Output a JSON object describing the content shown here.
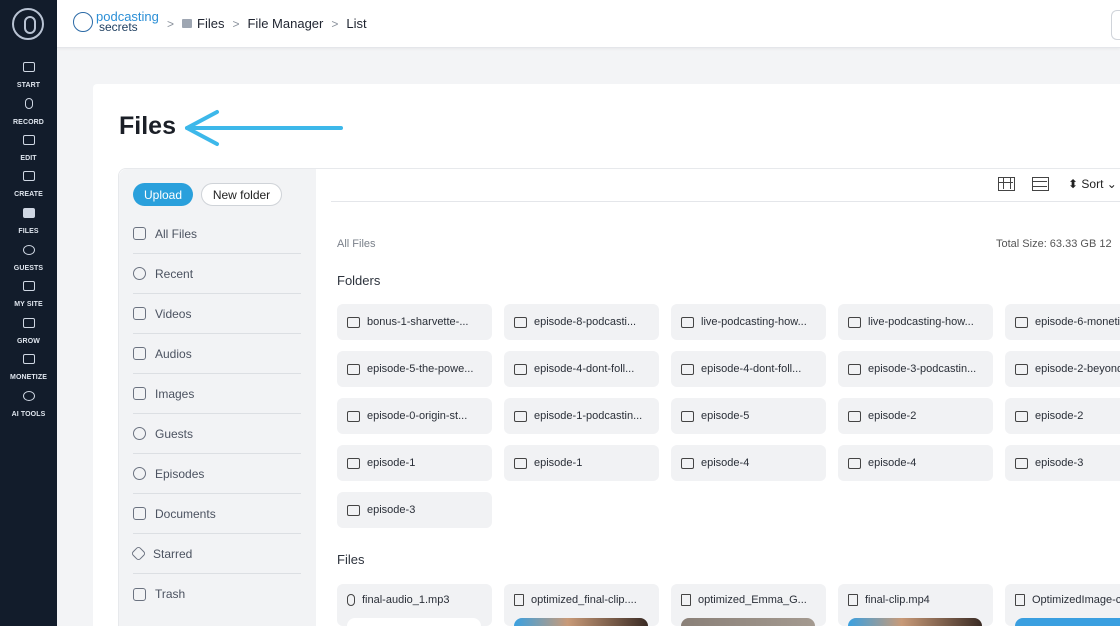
{
  "rail": {
    "items": [
      {
        "label": "START",
        "icon": "monitor-icon"
      },
      {
        "label": "RECORD",
        "icon": "microphone-icon"
      },
      {
        "label": "EDIT",
        "icon": "edit-icon"
      },
      {
        "label": "CREATE",
        "icon": "create-icon"
      },
      {
        "label": "FILES",
        "icon": "files-icon"
      },
      {
        "label": "GUESTS",
        "icon": "guests-icon"
      },
      {
        "label": "MY SITE",
        "icon": "site-icon"
      },
      {
        "label": "GROW",
        "icon": "grow-icon"
      },
      {
        "label": "MONETIZE",
        "icon": "monetize-icon"
      },
      {
        "label": "AI TOOLS",
        "icon": "ai-tools-icon"
      }
    ]
  },
  "brand": {
    "line1": "podcasting",
    "line2": "secrets"
  },
  "breadcrumb": {
    "sep1": ">",
    "files": "Files",
    "sep2": ">",
    "file_manager": "File Manager",
    "sep3": ">",
    "list": "List"
  },
  "page": {
    "title": "Files"
  },
  "actions": {
    "upload": "Upload",
    "new_folder": "New folder"
  },
  "sidebar": {
    "items": [
      {
        "label": "All Files",
        "icon": "folder-icon"
      },
      {
        "label": "Recent",
        "icon": "clock-icon"
      },
      {
        "label": "Videos",
        "icon": "video-icon"
      },
      {
        "label": "Audios",
        "icon": "music-icon"
      },
      {
        "label": "Images",
        "icon": "image-icon"
      },
      {
        "label": "Guests",
        "icon": "users-icon"
      },
      {
        "label": "Episodes",
        "icon": "episodes-icon"
      },
      {
        "label": "Documents",
        "icon": "document-icon"
      },
      {
        "label": "Starred",
        "icon": "star-icon"
      },
      {
        "label": "Trash",
        "icon": "trash-icon"
      }
    ]
  },
  "toolbar": {
    "sort": "⬍ Sort ⌄"
  },
  "content": {
    "crumb": "All Files",
    "total": "Total Size: 63.33 GB   12",
    "folders_heading": "Folders",
    "files_heading": "Files",
    "folders": [
      "bonus-1-sharvette-...",
      "episode-8-podcasti...",
      "live-podcasting-how...",
      "live-podcasting-how...",
      "episode-6-moneti",
      "episode-5-the-powe...",
      "episode-4-dont-foll...",
      "episode-4-dont-foll...",
      "episode-3-podcastin...",
      "episode-2-beyond",
      "episode-0-origin-st...",
      "episode-1-podcastin...",
      "episode-5",
      "episode-2",
      "episode-2",
      "episode-1",
      "episode-1",
      "episode-4",
      "episode-4",
      "episode-3",
      "episode-3"
    ],
    "files": [
      {
        "name": "final-audio_1.mp3",
        "icon": "microphone-icon"
      },
      {
        "name": "optimized_final-clip....",
        "icon": "video-file-icon"
      },
      {
        "name": "optimized_Emma_G...",
        "icon": "video-file-icon"
      },
      {
        "name": "final-clip.mp4",
        "icon": "video-file-icon"
      },
      {
        "name": "OptimizedImage-c",
        "icon": "image-icon"
      }
    ]
  },
  "colors": {
    "accent": "#2aa0dc",
    "rail": "#121c2b",
    "arrow": "#3db8ea"
  }
}
